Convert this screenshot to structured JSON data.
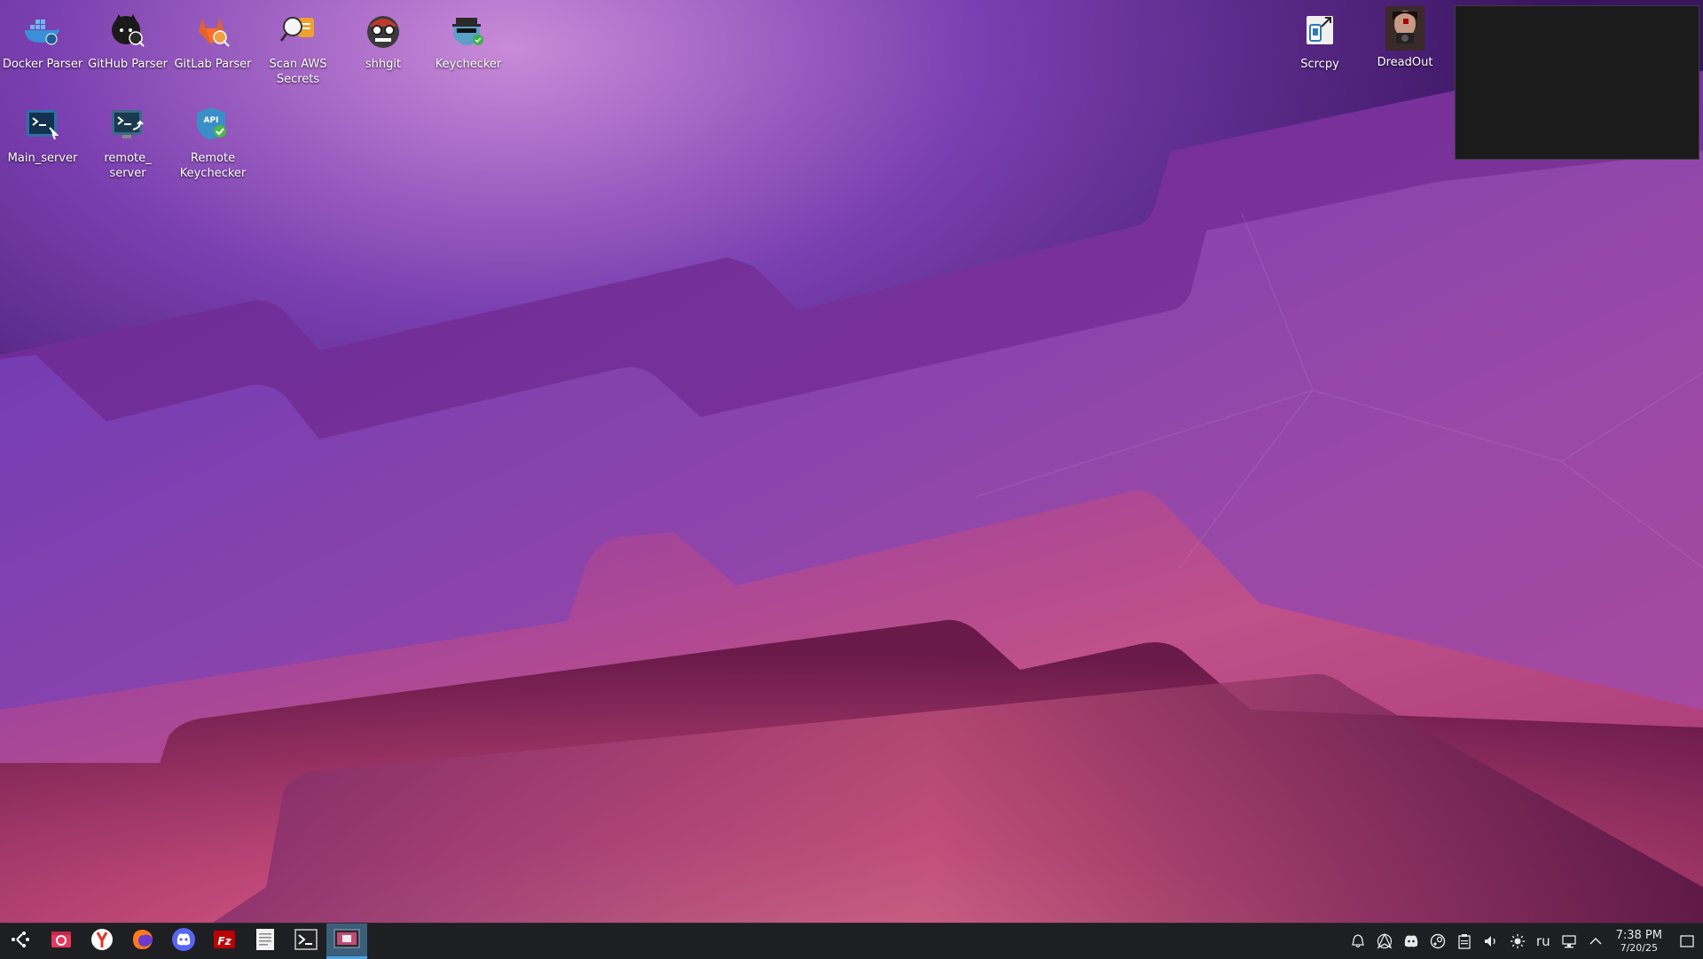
{
  "desktop": {
    "icons": [
      {
        "label": "Docker Parser",
        "icon": "docker-icon"
      },
      {
        "label": "GitHub Parser",
        "icon": "github-icon"
      },
      {
        "label": "GitLab Parser",
        "icon": "gitlab-icon"
      },
      {
        "label": "Scan AWS Secrets",
        "icon": "aws-scan-icon"
      },
      {
        "label": "shhgit",
        "icon": "shhgit-icon"
      },
      {
        "label": "Keychecker",
        "icon": "spy-icon"
      },
      {
        "label": "Main_server",
        "icon": "terminal-icon"
      },
      {
        "label": "remote_ server",
        "icon": "remote-terminal-icon"
      },
      {
        "label": "Remote Keychecker",
        "icon": "api-shield-icon"
      },
      {
        "label": "Scrcpy",
        "icon": "scrcpy-icon"
      },
      {
        "label": "DreadOut",
        "icon": "dreadout-icon"
      }
    ]
  },
  "taskbar": {
    "launchers": [
      {
        "name": "app-launcher",
        "icon": "kde-launcher-icon"
      },
      {
        "name": "screenshot-app",
        "icon": "camera-app-icon"
      },
      {
        "name": "yandex-browser",
        "icon": "yandex-icon"
      },
      {
        "name": "firefox",
        "icon": "firefox-icon"
      },
      {
        "name": "discord",
        "icon": "discord-icon"
      },
      {
        "name": "filezilla",
        "icon": "filezilla-icon"
      },
      {
        "name": "text-editor",
        "icon": "document-icon"
      },
      {
        "name": "terminal",
        "icon": "terminal-icon"
      },
      {
        "name": "active-window",
        "icon": "window-thumb-icon"
      }
    ],
    "tray": {
      "keyboard_layout": "ru",
      "time": "7:38 PM",
      "date": "7/20/25"
    }
  },
  "colors": {
    "taskbar_bg": "#1e1f23",
    "active_task": "#3b5e7a"
  }
}
